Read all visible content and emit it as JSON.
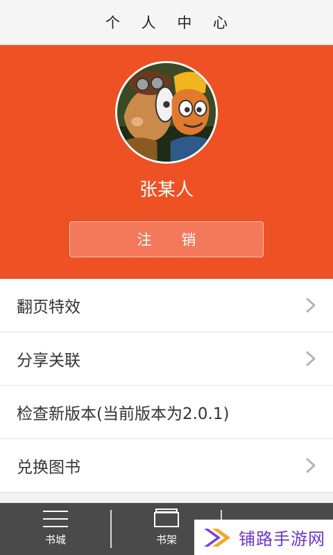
{
  "header": {
    "title": "个 人 中 心"
  },
  "profile": {
    "avatar_icon": "cartoon-avatar",
    "username": "张某人",
    "logout_label": "注 销",
    "background_color": "#ee5123"
  },
  "menu": {
    "items": [
      {
        "label": "翻页特效",
        "has_arrow": true
      },
      {
        "label": "分享关联",
        "has_arrow": true
      },
      {
        "label": "检查新版本(当前版本为2.0.1)",
        "has_arrow": false
      },
      {
        "label": "兑换图书",
        "has_arrow": true
      }
    ]
  },
  "tabbar": {
    "tabs": [
      {
        "label": "书城",
        "icon": "menu-lines-icon"
      },
      {
        "label": "书架",
        "icon": "bookshelf-icon"
      },
      {
        "label": "",
        "icon": "user-icon"
      }
    ]
  },
  "watermark": {
    "text": "铺路手游网"
  }
}
